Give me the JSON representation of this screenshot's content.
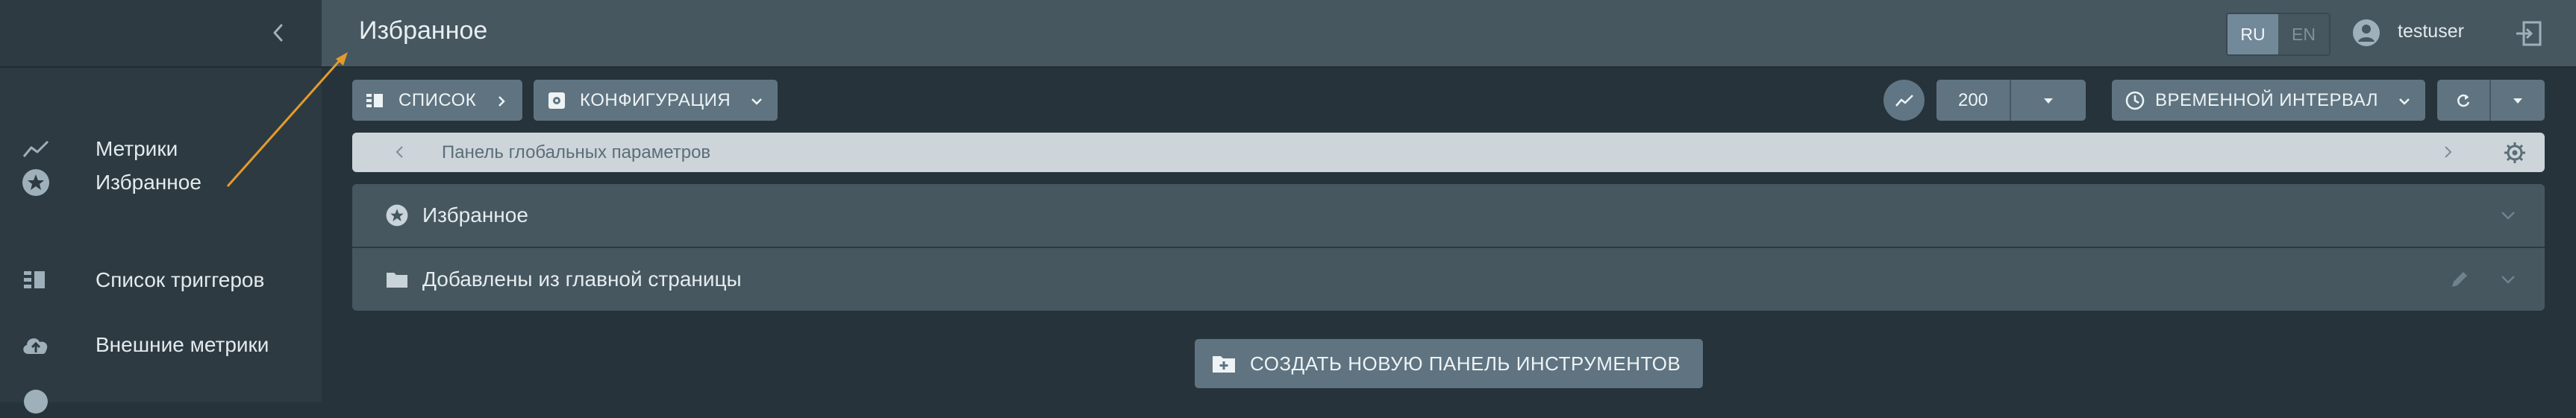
{
  "header": {
    "title": "Избранное"
  },
  "language": {
    "ru": "RU",
    "en": "EN",
    "active": "RU"
  },
  "user": {
    "name": "testuser"
  },
  "sidebar": {
    "items": [
      {
        "label": "Метрики",
        "icon": "line-chart-icon"
      },
      {
        "label": "Избранное",
        "icon": "star-circle-icon"
      },
      {
        "label": "Список триггеров",
        "icon": "list-icon"
      },
      {
        "label": "Внешние метрики",
        "icon": "cloud-upload-icon"
      }
    ]
  },
  "toolbar": {
    "list_label": "СПИСОК",
    "config_label": "КОНФИГУРАЦИЯ",
    "limit_value": "200",
    "time_interval_label": "ВРЕМЕННОЙ ИНТЕРВАЛ"
  },
  "params_bar": {
    "label": "Панель глобальных параметров"
  },
  "groups": [
    {
      "title": "Избранное",
      "icon": "star-circle-icon"
    },
    {
      "title": "Добавлены из главной страницы",
      "icon": "folder-icon"
    }
  ],
  "create_button": {
    "label": "СОЗДАТЬ НОВУЮ ПАНЕЛЬ ИНСТРУМЕНТОВ"
  },
  "colors": {
    "sidebar_bg": "#2d3a42",
    "header_bg": "#46575f",
    "page_bg": "#26333b",
    "button_bg": "#5f7480",
    "annotation_arrow": "#e39b2c"
  }
}
